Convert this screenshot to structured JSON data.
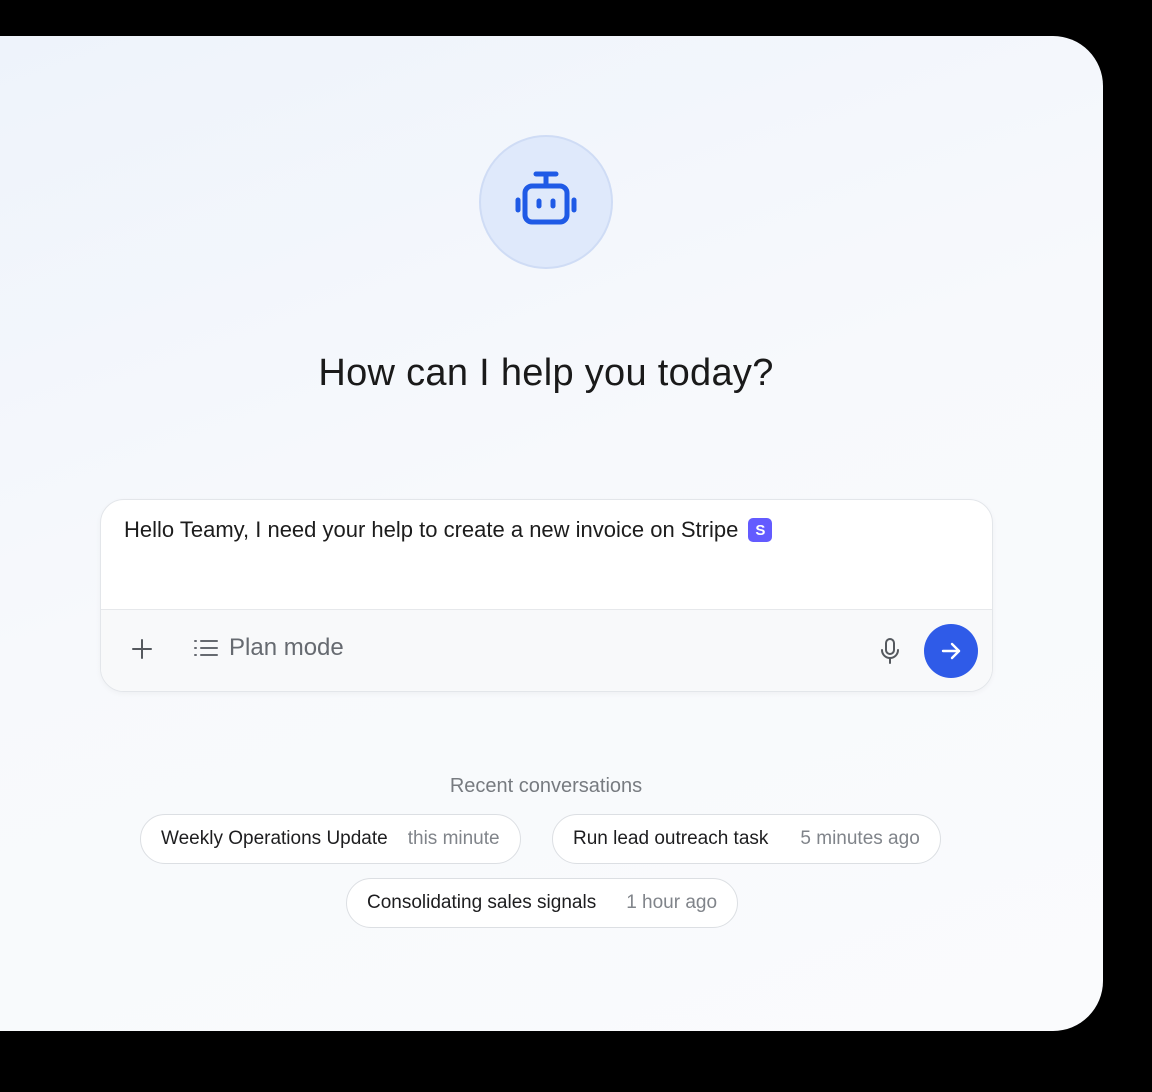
{
  "hero": {
    "icon": "robot-icon",
    "headline": "How can I help you today?"
  },
  "composer": {
    "value": "Hello Teamy, I need your help to create a new invoice on Stripe",
    "badge_letter": "S",
    "badge_color": "#635bff",
    "mode_label": "Plan mode",
    "send_color": "#2f5be8"
  },
  "recent": {
    "title": "Recent conversations",
    "items": [
      {
        "title": "Weekly Operations Update",
        "time": "this minute"
      },
      {
        "title": "Run lead outreach task",
        "time": "5 minutes ago"
      },
      {
        "title": "Consolidating sales signals",
        "time": "1 hour ago"
      }
    ]
  },
  "colors": {
    "accent": "#1f5ae6",
    "avatar_bg": "#dfe9fb"
  }
}
